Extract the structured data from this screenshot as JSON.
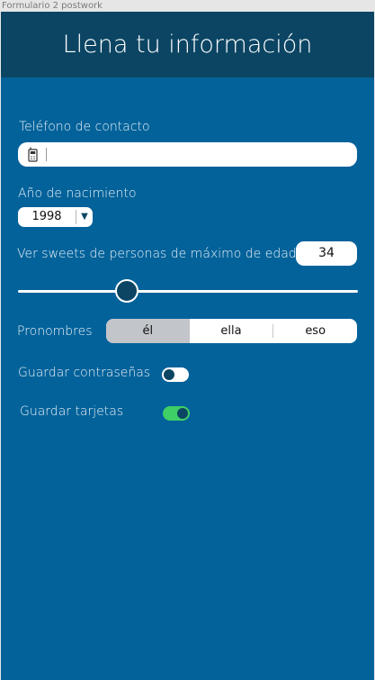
{
  "window": {
    "title": "Formulario 2 postwork"
  },
  "header": {
    "title": "Llena tu información"
  },
  "phone": {
    "label": "Teléfono de contacto",
    "value": "",
    "icon": "mobile-phone-icon"
  },
  "birth_year": {
    "label": "Año de nacimiento",
    "value": "1998"
  },
  "age_filter": {
    "label": "Ver sweets de personas de máximo de edad:",
    "value": "34"
  },
  "slider": {
    "value_fraction": 0.32
  },
  "pronouns": {
    "label": "Pronombres",
    "options": [
      "él",
      "ella",
      "eso"
    ],
    "selected": "él"
  },
  "toggles": {
    "save_passwords": {
      "label": "Guardar contraseñas",
      "on": false
    },
    "save_cards": {
      "label": "Guardar tarjetas",
      "on": true
    }
  },
  "colors": {
    "background": "#03629a",
    "header": "#0b4563",
    "toggle_on": "#3fcf67"
  }
}
